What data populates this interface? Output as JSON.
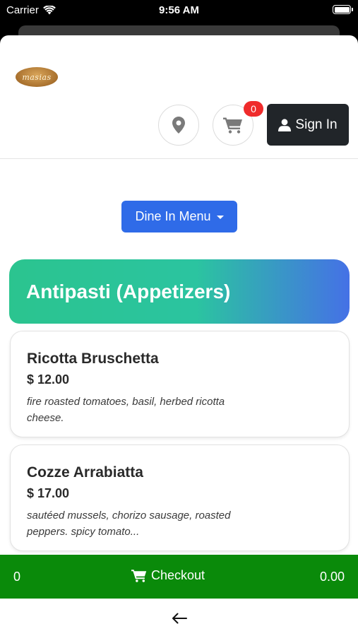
{
  "status_bar": {
    "carrier": "Carrier",
    "time": "9:56 AM"
  },
  "header": {
    "logo_text": "masias",
    "cart_count": "0",
    "sign_in_label": "Sign In",
    "icons": [
      "map-marker-icon",
      "shopping-cart-icon",
      "user-icon"
    ]
  },
  "menu_selector": {
    "label": "Dine In Menu"
  },
  "category": {
    "title": "Antipasti (Appetizers)",
    "gradient": [
      "#2bc48f",
      "#4571e6"
    ]
  },
  "items": [
    {
      "name": "Ricotta Bruschetta",
      "price": "$ 12.00",
      "description": "fire roasted tomatoes, basil, herbed ricotta cheese."
    },
    {
      "name": "Cozze Arrabiatta",
      "price": "$ 17.00",
      "description": "sautéed mussels, chorizo sausage, roasted peppers. spicy tomato..."
    }
  ],
  "checkout_bar": {
    "count": "0",
    "label": "Checkout",
    "total": "0.00",
    "color": "#0a8a0a"
  },
  "colors": {
    "primary": "#2f6be8",
    "dark_button": "#212529",
    "badge": "#ef2b2b"
  }
}
